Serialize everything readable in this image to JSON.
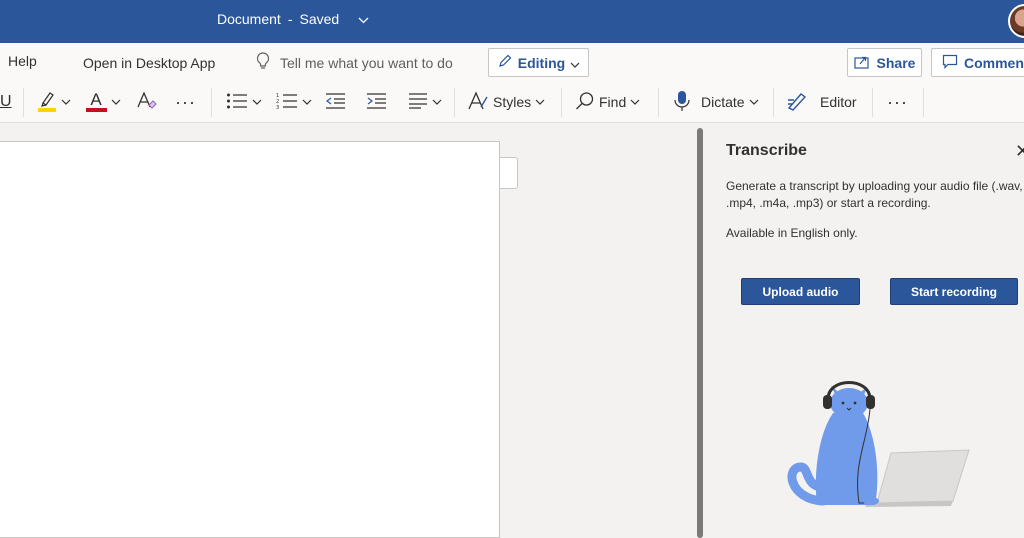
{
  "titlebar": {
    "doc_name": "Document",
    "separator": "-",
    "save_status": "Saved",
    "chevron": "⌵"
  },
  "menu": {
    "help": "Help",
    "open_desktop": "Open in Desktop App",
    "tell_me": "Tell me what you want to do",
    "editing": "Editing",
    "share": "Share",
    "comments": "Comments"
  },
  "ribbon": {
    "underline": "U",
    "font_color_letter": "A",
    "more": "···",
    "styles": "Styles",
    "find": "Find",
    "dictate": "Dictate",
    "editor": "Editor",
    "overflow": "···",
    "highlight_color": "#ffd400",
    "font_color": "#c50f1f",
    "accent_color": "#2b579a"
  },
  "pane": {
    "title": "Transcribe",
    "close": "✕",
    "description": "Generate a transcript by uploading your audio file (.wav, .mp4, .m4a, .mp3) or start a recording.",
    "availability": "Available in English only.",
    "upload_button": "Upload audio",
    "record_button": "Start recording"
  },
  "colors": {
    "titlebar": "#2b579a",
    "button": "#2b579a",
    "cat": "#6f9bea"
  }
}
